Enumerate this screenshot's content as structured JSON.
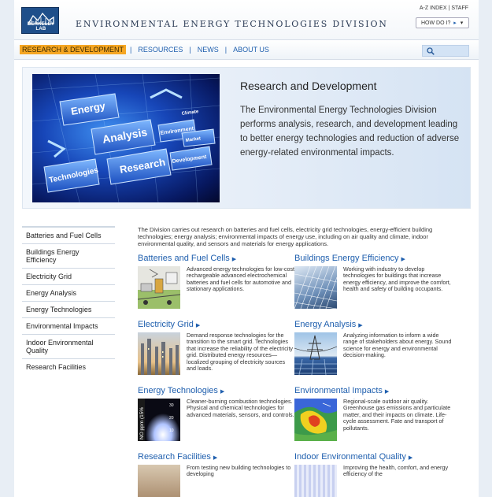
{
  "header": {
    "logo_text": "BERKELEY LAB",
    "division_title": "ENVIRONMENTAL ENERGY TECHNOLOGIES DIVISION",
    "util_links": [
      "A-Z INDEX",
      "STAFF"
    ],
    "util_sep": "|",
    "howdo_label": "HOW DO I?"
  },
  "nav": {
    "items": [
      {
        "label": "RESEARCH & DEVELOPMENT"
      },
      {
        "label": "RESOURCES"
      },
      {
        "label": "NEWS"
      },
      {
        "label": "ABOUT US"
      }
    ],
    "sep": "|"
  },
  "hero": {
    "title": "Research and Development",
    "text": "The Environmental Energy Technologies Division performs analysis, research, and development leading to better energy technologies and reduction of adverse energy-related environmental impacts.",
    "image_words": [
      "Energy",
      "Analysis",
      "Research",
      "Technologies",
      "Environment",
      "Development",
      "Market",
      "Climate"
    ]
  },
  "sidebar": {
    "items": [
      {
        "label": "Batteries and Fuel Cells"
      },
      {
        "label": "Buildings Energy Efficiency"
      },
      {
        "label": "Electricity Grid"
      },
      {
        "label": "Energy Analysis"
      },
      {
        "label": "Energy Technologies"
      },
      {
        "label": "Environmental Impacts"
      },
      {
        "label": "Indoor Environmental Quality"
      },
      {
        "label": "Research Facilities"
      }
    ]
  },
  "main": {
    "intro": "The Division carries out research on batteries and fuel cells, electricity grid technologies, energy-efficient building technologies; energy analysis; environmental impacts of energy use, including on air quality and climate, indoor environmental quality, and sensors and materials for energy applications.",
    "cards": [
      {
        "title": "Batteries and Fuel Cells",
        "text": "Advanced energy technologies for low-cost rechargeable advanced electrochemical batteries and fuel cells for automotive and stationary applications."
      },
      {
        "title": "Buildings Energy Efficiency",
        "text": "Working with industry to develop technologies for buildings that increase energy efficiency, and improve the comfort, health and safety of building occupants."
      },
      {
        "title": "Electricity Grid",
        "text": "Demand response technologies for the transition to the smart grid. Technologies that increase the reliability of the electricity grid. Distributed energy resources—localized grouping of electricity sources and loads."
      },
      {
        "title": "Energy Analysis",
        "text": "Analyzing information to inform a wide range of stakeholders about energy. Sound science for energy and environmental decision-making."
      },
      {
        "title": "Energy Technologies",
        "text": "Cleaner-burning combustion technologies. Physical and chemical technologies for advanced materials, sensors, and controls."
      },
      {
        "title": "Environmental Impacts",
        "text": "Regional-scale outdoor air quality. Greenhouse gas emissions and particulate matter, and their impacts on climate. Life-cycle assessment. Fate and transport of pollutants."
      },
      {
        "title": "Research Facilities",
        "text": "From testing new building technologies to developing"
      },
      {
        "title": "Indoor Environmental Quality",
        "text": "Improving the health, comfort, and energy efficiency of the"
      }
    ],
    "energy_tech_img_labels": {
      "axis": "NO ppm (15%",
      "ticks": [
        "30",
        "20",
        "10"
      ]
    }
  },
  "colors": {
    "nav_active_bg": "#f5a623",
    "link_blue": "#1f5fae",
    "logo_blue": "#1f4f8a"
  },
  "icons": [
    "search-icon",
    "chevron-right-icon",
    "caret-right-icon"
  ]
}
